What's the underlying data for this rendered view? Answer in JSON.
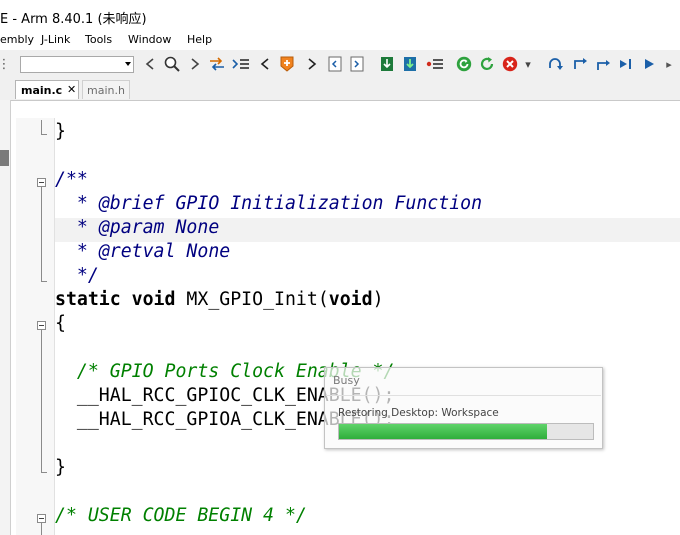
{
  "window": {
    "title": "E - Arm 8.40.1 (未响应)"
  },
  "menu": {
    "items": [
      "embly",
      "J-Link",
      "Tools",
      "Window",
      "Help"
    ]
  },
  "toolbar": {
    "combo_value": "",
    "icons": [
      "chevron-left-icon",
      "magnifier-icon",
      "chevron-right-icon",
      "navigate-back-icon",
      "bookmark-list-icon",
      "prev-bookmark-icon",
      "toggle-bookmark-icon",
      "next-bookmark-icon",
      "bookmark-page-icon",
      "bookmark-page2-icon",
      "download-icon",
      "download-alt-icon",
      "list-icon",
      "go-icon",
      "reset-icon",
      "stop-icon",
      "step-over-icon",
      "step-into-icon",
      "step-out-icon",
      "run-to-cursor-icon",
      "run-icon"
    ]
  },
  "tabs": [
    {
      "label": "main.c",
      "active": true,
      "close": "✕"
    },
    {
      "label": "main.h",
      "active": false
    }
  ],
  "code": {
    "line1": "}",
    "line3": "/**",
    "line4_star": "  * ",
    "line4_tag": "@brief",
    "line4_text": " GPIO Initialization Function",
    "line5_star": "  * ",
    "line5_tag": "@param",
    "line5_text": " None",
    "line6_star": "  * ",
    "line6_tag": "@retval",
    "line6_text": " None",
    "line7": "  */",
    "line8_kw1": "static",
    "line8_kw2": "void",
    "line8_name": " MX_GPIO_Init(",
    "line8_kw3": "void",
    "line8_close": ")",
    "line9": "{",
    "line11": "  /* GPIO Ports Clock Enable */",
    "line12": "  __HAL_RCC_GPIOC_CLK_ENABLE();",
    "line13": "  __HAL_RCC_GPIOA_CLK_ENABLE();",
    "line15": "}",
    "line17": "/* USER CODE BEGIN 4 */"
  },
  "busy_dialog": {
    "title": "Busy",
    "message": "Restoring Desktop: Workspace",
    "progress_fraction": 0.82
  },
  "colors": {
    "keyword": "#000000",
    "comment": "#008000",
    "doc_comment": "#000080",
    "progress": "#2fae3b"
  }
}
